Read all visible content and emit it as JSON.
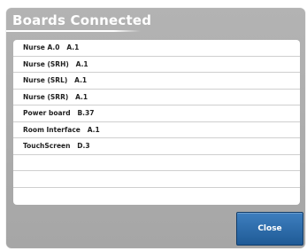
{
  "dialog": {
    "title": "Boards Connected",
    "close_label": "Close",
    "accent_color": "#2a6aa8",
    "boards": [
      {
        "text": "Nurse A.0   A.1"
      },
      {
        "text": "Nurse (SRH)   A.1"
      },
      {
        "text": "Nurse (SRL)   A.1"
      },
      {
        "text": "Nurse (SRR)   A.1"
      },
      {
        "text": "Power board   B.37"
      },
      {
        "text": "Room Interface   A.1"
      },
      {
        "text": "TouchScreen   D.3"
      },
      {
        "text": ""
      },
      {
        "text": ""
      },
      {
        "text": ""
      }
    ]
  }
}
